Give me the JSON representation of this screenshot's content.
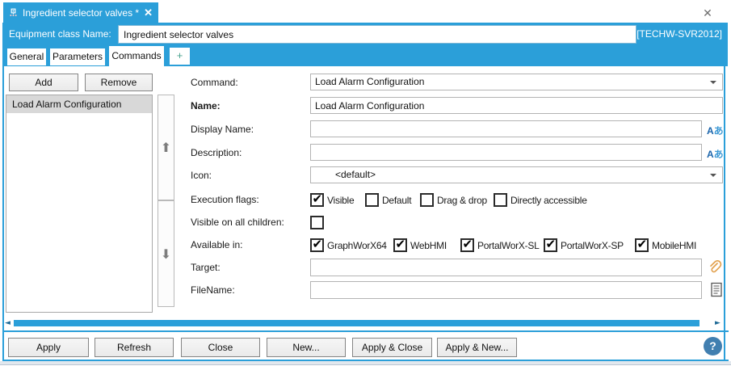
{
  "doc_tab": {
    "title": "Ingredient selector valves *",
    "close_icon": "✕"
  },
  "window": {
    "close_icon": "✕"
  },
  "header": {
    "label": "Equipment class Name:",
    "value": "Ingredient selector valves",
    "server": "[TECHW-SVR2012]"
  },
  "tabs": {
    "general": "General",
    "parameters": "Parameters",
    "commands": "Commands",
    "add_tab": "+"
  },
  "left_panel": {
    "add": "Add",
    "remove": "Remove",
    "items": [
      "Load Alarm Configuration"
    ]
  },
  "form": {
    "command": {
      "label": "Command:",
      "value": "Load Alarm Configuration"
    },
    "name": {
      "label": "Name:",
      "value": "Load Alarm Configuration"
    },
    "display_name": {
      "label": "Display Name:",
      "value": "",
      "lang_icon": "Aあ"
    },
    "description": {
      "label": "Description:",
      "value": "",
      "lang_icon": "Aあ"
    },
    "icon": {
      "label": "Icon:",
      "value": "<default>"
    },
    "execution_flags": {
      "label": "Execution flags:",
      "options": [
        {
          "label": "Visible",
          "checked": true
        },
        {
          "label": "Default",
          "checked": false
        },
        {
          "label": "Drag & drop",
          "checked": false
        },
        {
          "label": "Directly accessible",
          "checked": false
        }
      ]
    },
    "visible_all_children": {
      "label": "Visible on all children:",
      "checked": false
    },
    "available_in": {
      "label": "Available in:",
      "options": [
        {
          "label": "GraphWorX64",
          "checked": true
        },
        {
          "label": "WebHMI",
          "checked": true
        },
        {
          "label": "PortalWorX-SL",
          "checked": true
        },
        {
          "label": "PortalWorX-SP",
          "checked": true
        },
        {
          "label": "MobileHMI",
          "checked": true
        }
      ]
    },
    "target": {
      "label": "Target:",
      "value": ""
    },
    "filename": {
      "label": "FileName:",
      "value": ""
    }
  },
  "footer": {
    "buttons": [
      "Apply",
      "Refresh",
      "Close",
      "New...",
      "Apply & Close",
      "Apply & New..."
    ],
    "help": "?"
  },
  "colors": {
    "accent": "#2B9FD9",
    "selection": "#D8D8D8",
    "help_blue": "#417FB0",
    "paperclip": "#E2A14E"
  }
}
